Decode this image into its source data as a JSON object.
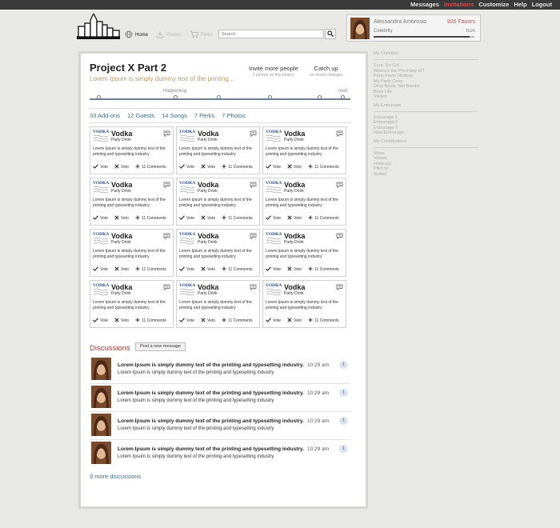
{
  "topnav": [
    "Messages",
    "Invitations",
    "Customize",
    "Help",
    "Logout"
  ],
  "topnav_active": 1,
  "nav": {
    "home": "Home",
    "parties": "Parties",
    "perks": "Perks"
  },
  "search": {
    "placeholder": "Search"
  },
  "profile": {
    "name": "Alessandra Ambrosio",
    "favors": "926 Favors",
    "status": "Celebrity",
    "icon_label": "Icon",
    "progress": 0.95
  },
  "project": {
    "title": "Project X Part 2",
    "subtitle": "Lorem Ipsum is simply dummy text of the printing...",
    "invite_label": "Invite more people",
    "invite_sub": "1 person on this project",
    "catchup_label": "Catch up",
    "catchup_sub": "on recent changes",
    "timeline_happening": "Happening",
    "timeline_next": "next"
  },
  "stats": [
    "33 Add-ons",
    "12 Guests",
    "14 Songs",
    "7 Perks",
    "7 Photos"
  ],
  "cards": [
    {
      "title": "Vodka",
      "subtitle": "Party Drink",
      "desc": "Lorem Ipsum is simply dummy text of the printing and typesetting industry",
      "vote": "Vote",
      "veto": "Veto",
      "comments": "11 Comments",
      "logo_text": "VODKA"
    },
    {
      "title": "Vodka",
      "subtitle": "Party Drink",
      "desc": "Lorem Ipsum is simply dummy text of the printing and typesetting industry",
      "vote": "Vote",
      "veto": "Veto",
      "comments": "11 Comments",
      "logo_text": "VODKA"
    },
    {
      "title": "Vodka",
      "subtitle": "Party Drink",
      "desc": "Lorem Ipsum is simply dummy text of the printing and typesetting industry",
      "vote": "Vote",
      "veto": "Veto",
      "comments": "11 Comments",
      "logo_text": "VODKA"
    },
    {
      "title": "Vodka",
      "subtitle": "Party Drink",
      "desc": "Lorem Ipsum is simply dummy text of the printing and typesetting industry",
      "vote": "Vote",
      "veto": "Veto",
      "comments": "11 Comments",
      "logo_text": "VODKA"
    },
    {
      "title": "Vodka",
      "subtitle": "Party Drink",
      "desc": "Lorem Ipsum is simply dummy text of the printing and typesetting industry",
      "vote": "Vote",
      "veto": "Veto",
      "comments": "11 Comments",
      "logo_text": "VODKA"
    },
    {
      "title": "Vodka",
      "subtitle": "Party Drink",
      "desc": "Lorem Ipsum is simply dummy text of the printing and typesetting industry",
      "vote": "Vote",
      "veto": "Veto",
      "comments": "11 Comments",
      "logo_text": "VODKA"
    },
    {
      "title": "Vodka",
      "subtitle": "Party Drink",
      "desc": "Lorem Ipsum is simply dummy text of the printing and typesetting industry",
      "vote": "Vote",
      "veto": "Veto",
      "comments": "11 Comments",
      "logo_text": "VODKA"
    },
    {
      "title": "Vodka",
      "subtitle": "Party Drink",
      "desc": "Lorem Ipsum is simply dummy text of the printing and typesetting industry",
      "vote": "Vote",
      "veto": "Veto",
      "comments": "11 Comments",
      "logo_text": "VODKA"
    },
    {
      "title": "Vodka",
      "subtitle": "Party Drink",
      "desc": "Lorem Ipsum is simply dummy text of the printing and typesetting industry",
      "vote": "Vote",
      "veto": "Veto",
      "comments": "11 Comments",
      "logo_text": "VODKA"
    },
    {
      "title": "Vodka",
      "subtitle": "Party Drink",
      "desc": "Lorem Ipsum is simply dummy text of the printing and typesetting industry",
      "vote": "Vote",
      "veto": "Veto",
      "comments": "11 Comments",
      "logo_text": "VODKA"
    },
    {
      "title": "Vodka",
      "subtitle": "Party Drink",
      "desc": "Lorem Ipsum is simply dummy text of the printing and typesetting industry",
      "vote": "Vote",
      "veto": "Veto",
      "comments": "11 Comments",
      "logo_text": "VODKA"
    },
    {
      "title": "Vodka",
      "subtitle": "Party Drink",
      "desc": "Lorem Ipsum is simply dummy text of the printing and typesetting industry",
      "vote": "Vote",
      "veto": "Veto",
      "comments": "11 Comments",
      "logo_text": "VODKA"
    }
  ],
  "discussions": {
    "title": "Discussions",
    "new_button": "Post a new message",
    "items": [
      {
        "title": "Lorem Ipsum is simply dummy text of the printing and typesetting industry.",
        "text": "Lorem Ipsum is simply dummy text of the printing and typesetting industry",
        "time": "10:29 am",
        "count": "1"
      },
      {
        "title": "Lorem Ipsum is simply dummy text of the printing and typesetting industry.",
        "text": "Lorem Ipsum is simply dummy text of the printing and typesetting industry",
        "time": "10:29 am",
        "count": "1"
      },
      {
        "title": "Lorem Ipsum is simply dummy text of the printing and typesetting industry.",
        "text": "Lorem Ipsum is simply dummy text of the printing and typesetting industry",
        "time": "10:29 am",
        "count": "1"
      },
      {
        "title": "Lorem Ipsum is simply dummy text of the printing and typesetting industry.",
        "text": "Lorem Ipsum is simply dummy text of the printing and typesetting industry",
        "time": "10:29 am",
        "count": "1"
      }
    ],
    "more": "3 more discussions"
  },
  "sidebar": [
    {
      "heading": "My Checklist",
      "items": [
        "Sure, No Go!",
        "Where's the Pre-Party at?",
        "Party Favor Hookup",
        "My Party Crew",
        "Drop Beats, Not Bombs",
        "Boss Life",
        "Visited"
      ]
    },
    {
      "heading": "My Entourage",
      "items": [
        "Entourage 1",
        "Entourage 2",
        "Entourage 3",
        "New Entourage"
      ]
    },
    {
      "heading": "My Contributions",
      "items": [
        "Votes",
        "Vetoes",
        "Hook-Up",
        "Pitch In",
        "Invites"
      ]
    }
  ],
  "colors": {
    "accent": "#e04a4a",
    "link": "#3a6b8c",
    "discussion_title": "#b03434",
    "timeline": "#6d7f95"
  }
}
